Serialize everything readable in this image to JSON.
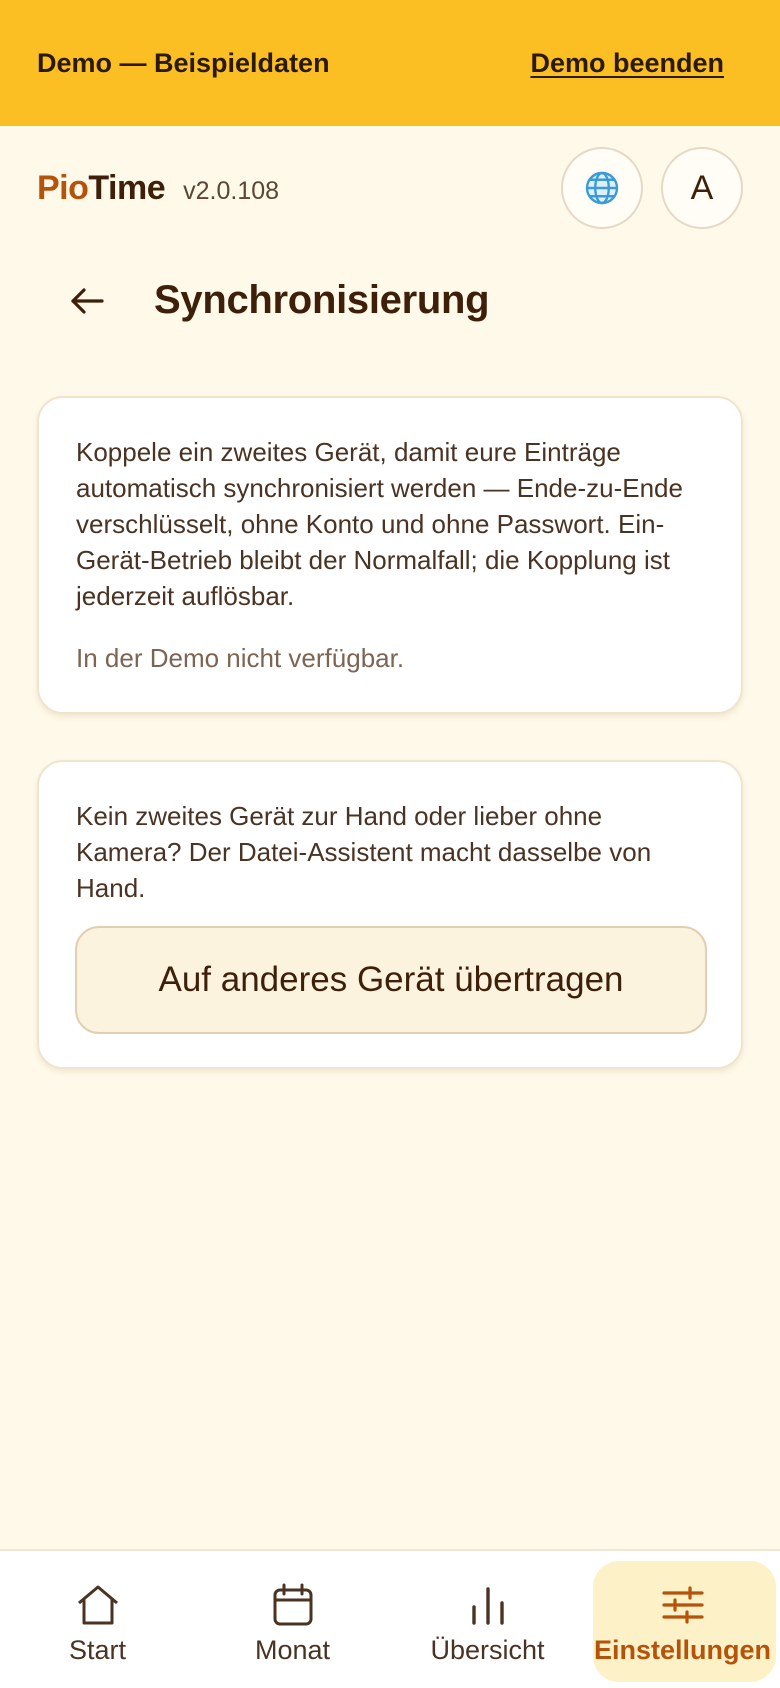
{
  "banner": {
    "text": "Demo — Beispieldaten",
    "end_label": "Demo beenden"
  },
  "header": {
    "brand_part1": "Pio",
    "brand_part2": "Time",
    "version": "v2.0.108",
    "language_icon": "globe-icon",
    "avatar_letter": "A"
  },
  "page": {
    "title": "Synchronisierung",
    "back_icon": "arrow-left-icon"
  },
  "cards": {
    "pairing": {
      "description": "Koppele ein zweites Gerät, damit eure Einträge automatisch synchronisiert werden — Ende-zu-Ende verschlüsselt, ohne Konto und ohne Passwort. Ein-Gerät-Betrieb bleibt der Normalfall; die Kopplung ist jederzeit auflösbar.",
      "demo_note": "In der Demo nicht verfügbar."
    },
    "file_assistant": {
      "description": "Kein zweites Gerät zur Hand oder lieber ohne Kamera? Der Datei-Assistent macht dasselbe von Hand.",
      "button_label": "Auf anderes Gerät übertragen"
    }
  },
  "nav": {
    "items": [
      {
        "label": "Start",
        "icon": "home-icon"
      },
      {
        "label": "Monat",
        "icon": "calendar-icon"
      },
      {
        "label": "Übersicht",
        "icon": "bar-chart-icon"
      },
      {
        "label": "Einstellungen",
        "icon": "sliders-icon",
        "active": true
      }
    ]
  },
  "colors": {
    "banner_bg": "#fbbf24",
    "page_bg": "#fef9e8",
    "accent": "#b45309",
    "text": "#3d1f0a"
  }
}
